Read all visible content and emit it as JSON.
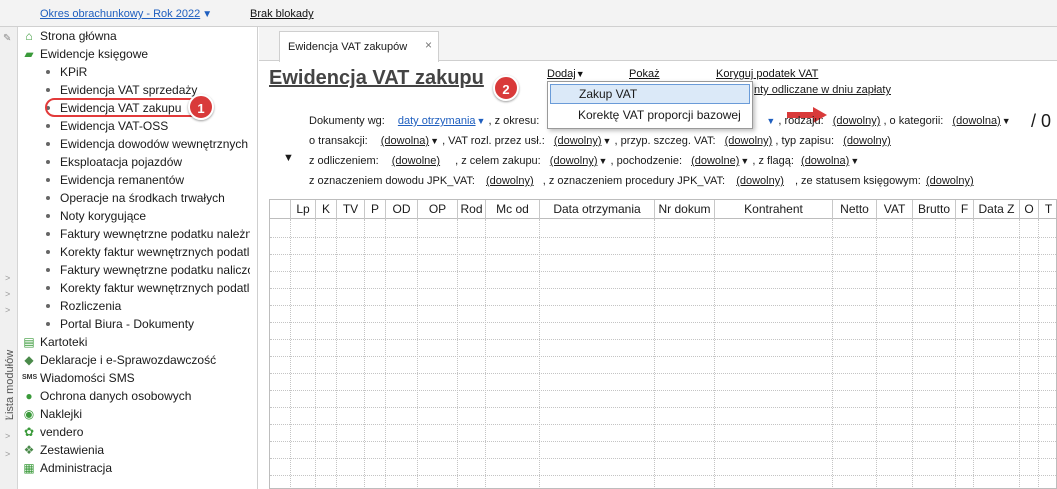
{
  "topbar": {
    "period": "Okres obrachunkowy - Rok 2022",
    "block": "Brak blokady"
  },
  "side_strip": {
    "label": "Lista modułów"
  },
  "tree": {
    "items": [
      {
        "label": "Strona główna",
        "level": 0,
        "icon": "home-icon"
      },
      {
        "label": "Ewidencje księgowe",
        "level": 0,
        "icon": "books-icon"
      },
      {
        "label": "KPiR",
        "level": 1
      },
      {
        "label": "Ewidencja VAT sprzedaży",
        "level": 1
      },
      {
        "label": "Ewidencja VAT zakupu",
        "level": 1
      },
      {
        "label": "Ewidencja VAT-OSS",
        "level": 1
      },
      {
        "label": "Ewidencja dowodów wewnętrznych",
        "level": 1
      },
      {
        "label": "Eksploatacja pojazdów",
        "level": 1
      },
      {
        "label": "Ewidencja remanentów",
        "level": 1
      },
      {
        "label": "Operacje na środkach trwałych",
        "level": 1
      },
      {
        "label": "Noty korygujące",
        "level": 1
      },
      {
        "label": "Faktury wewnętrzne podatku należn",
        "level": 1
      },
      {
        "label": "Korekty faktur wewnętrznych podatl",
        "level": 1
      },
      {
        "label": "Faktury wewnętrzne podatku naliczo",
        "level": 1
      },
      {
        "label": "Korekty faktur wewnętrznych podatl",
        "level": 1
      },
      {
        "label": "Rozliczenia",
        "level": 1
      },
      {
        "label": "Portal Biura - Dokumenty",
        "level": 1
      },
      {
        "label": "Kartoteki",
        "level": 0,
        "icon": "cards-icon"
      },
      {
        "label": "Deklaracje i e-Sprawozdawczość",
        "level": 0,
        "icon": "declarations-icon"
      },
      {
        "label": "Wiadomości SMS",
        "level": 0,
        "icon": "sms-icon"
      },
      {
        "label": "Ochrona danych osobowych",
        "level": 0,
        "icon": "shield-icon"
      },
      {
        "label": "Naklejki",
        "level": 0,
        "icon": "sticker-icon"
      },
      {
        "label": "vendero",
        "level": 0,
        "icon": "vendero-icon"
      },
      {
        "label": "Zestawienia",
        "level": 0,
        "icon": "reports-icon"
      },
      {
        "label": "Administracja",
        "level": 0,
        "icon": "admin-icon"
      }
    ],
    "highlighted_index": 4
  },
  "badges": {
    "one": "1",
    "two": "2"
  },
  "tab": {
    "label": "Ewidencja VAT zakupów",
    "close": "×"
  },
  "page": {
    "title": "Ewidencja VAT zakupu",
    "menu": {
      "add": "Dodaj",
      "show": "Pokaż",
      "correct_tax": "Koryguj podatek VAT",
      "sub_info": "nty odliczane w dniu zapłaty"
    },
    "dropdown": {
      "items": [
        "Zakup VAT",
        "Korektę VAT proporcji bazowej"
      ],
      "selected_index": 0
    }
  },
  "filters": {
    "row1": {
      "docs_label": "Dokumenty wg:",
      "docs_value": "daty otrzymania",
      "period_label": ", z okresu:",
      "kind_label": ", rodzaju:",
      "kind_value": "(dowolny)",
      "category_label": ", o kategorii:",
      "category_value": "(dowolna)",
      "count": "/ 0"
    },
    "row2": {
      "transaction_label": "o transakcji:",
      "transaction_value": "(dowolna)",
      "vat_label": ", VAT rozl. przez usł.:",
      "vat_value": "(dowolny)",
      "spec_label": ", przyp. szczeg. VAT:",
      "spec_value": "(dowolny)",
      "type_label": ", typ zapisu:",
      "type_value": "(dowolny)"
    },
    "row3": {
      "deduction_label": "z odliczeniem:",
      "deduction_value": "(dowolne)",
      "purpose_label": ", z celem zakupu:",
      "purpose_value": "(dowolny)",
      "origin_label": ", pochodzenie:",
      "origin_value": "(dowolne)",
      "flag_label": ", z flagą:",
      "flag_value": "(dowolna)"
    },
    "row4": {
      "jpk_label": "z oznaczeniem dowodu JPK_VAT:",
      "jpk_value": "(dowolny)",
      "proc_label": ", z oznaczeniem procedury JPK_VAT:",
      "proc_value": "(dowolny)",
      "status_label": ", ze statusem księgowym:",
      "status_value": "(dowolny)"
    }
  },
  "grid": {
    "columns": [
      "Lp",
      "K",
      "TV",
      "P",
      "OD",
      "OP",
      "Rod",
      "Mc od",
      "Data otrzymania",
      "Nr dokum",
      "Kontrahent",
      "Netto",
      "VAT",
      "Brutto",
      "F",
      "Data Z",
      "O",
      "T"
    ]
  },
  "colors": {
    "accent_red": "#d93a3a",
    "link_blue": "#1f5fbf",
    "selection": "#dbe9f8"
  }
}
